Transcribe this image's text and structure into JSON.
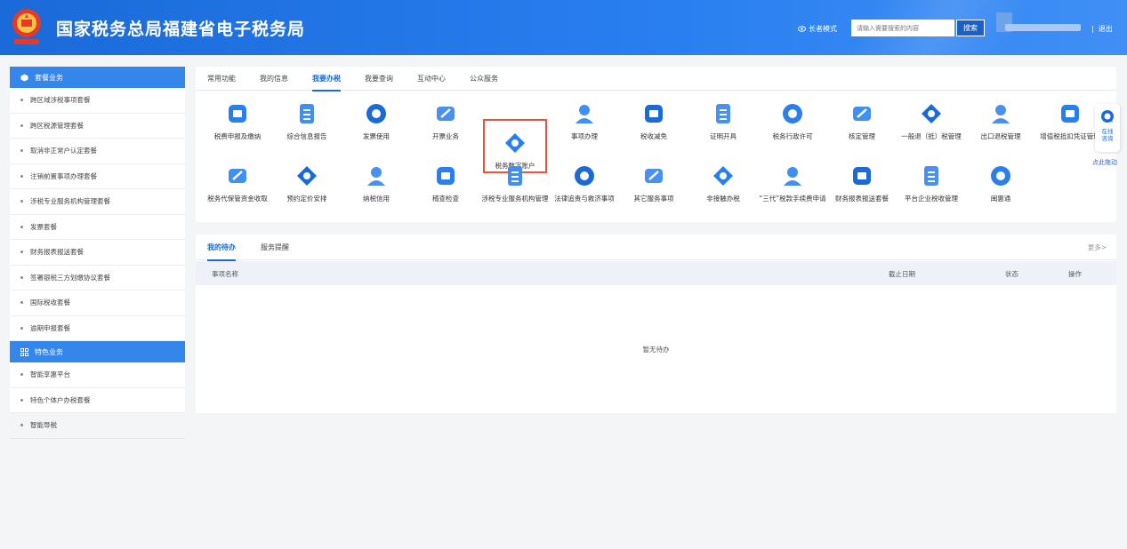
{
  "header": {
    "title": "国家税务总局福建省电子税务局",
    "elder_mode": "长者模式",
    "search_placeholder": "请输入需要搜索的内容",
    "search_button": "搜索",
    "logout": "退出",
    "divider": "|",
    "colors": {
      "primary": "#1a6ad9",
      "highlight": "#e8543b"
    }
  },
  "sidebar": {
    "section1": {
      "title": "套餐业务",
      "icon": "package-icon"
    },
    "items1": [
      "跨区域涉税事项套餐",
      "跨区税源管理套餐",
      "取消非正常户认定套餐",
      "注销前置事项办理套餐",
      "涉税专业服务机构管理套餐",
      "发票套餐",
      "财务报表报送套餐",
      "签署银税三方划缴协议套餐",
      "国际税收套餐",
      "逾期申报套餐"
    ],
    "section2": {
      "title": "特色业务",
      "icon": "grid-icon"
    },
    "items2": [
      "智能享惠平台",
      "特色个体户办税套餐",
      "智能导税"
    ]
  },
  "main": {
    "tabs": [
      "常用功能",
      "我的信息",
      "我要办税",
      "我要查询",
      "互动中心",
      "公众服务"
    ],
    "active_tab": "我要办税",
    "services_row1": [
      {
        "label": "税费申报及缴纳",
        "icon": "tax-declare-icon"
      },
      {
        "label": "综合信息报告",
        "icon": "report-icon"
      },
      {
        "label": "发票使用",
        "icon": "invoice-icon"
      },
      {
        "label": "开票业务",
        "icon": "issue-invoice-icon"
      },
      {
        "label": "税务数字账户",
        "icon": "digital-account-icon"
      },
      {
        "label": "事项办理",
        "icon": "edit-icon"
      },
      {
        "label": "税收减免",
        "icon": "tax-relief-icon"
      },
      {
        "label": "证明开具",
        "icon": "certificate-icon"
      },
      {
        "label": "税务行政许可",
        "icon": "license-icon"
      },
      {
        "label": "核定管理",
        "icon": "verify-manage-icon"
      },
      {
        "label": "一般退（抵）税管理",
        "icon": "refund-icon"
      },
      {
        "label": "出口退税管理",
        "icon": "export-refund-icon"
      },
      {
        "label": "增值税抵扣凭证管理",
        "icon": "vat-voucher-icon"
      }
    ],
    "services_row2": [
      {
        "label": "税务代保管资金收取",
        "icon": "money-bag-icon"
      },
      {
        "label": "预约定价安排",
        "icon": "pricing-icon"
      },
      {
        "label": "纳税信用",
        "icon": "credit-icon"
      },
      {
        "label": "稽查检查",
        "icon": "inspector-icon"
      },
      {
        "label": "涉税专业服务机构管理",
        "icon": "agency-icon"
      },
      {
        "label": "法律追责与救济事项",
        "icon": "gavel-icon"
      },
      {
        "label": "其它服务事项",
        "icon": "other-service-icon"
      },
      {
        "label": "非接触办税",
        "icon": "contactless-icon"
      },
      {
        "label": "“三代”税款手续费申请",
        "icon": "fee-apply-icon"
      },
      {
        "label": "财务报表报送套餐",
        "icon": "financial-report-icon"
      },
      {
        "label": "平台企业税收管理",
        "icon": "platform-tax-icon"
      },
      {
        "label": "闽惠通",
        "icon": "bulb-icon"
      }
    ],
    "highlighted": "税务数字账户"
  },
  "float": {
    "line1": "在线",
    "line2": "咨询",
    "drag_hint": "点此拖动"
  },
  "todo": {
    "tabs": [
      "我的待办",
      "服务提醒"
    ],
    "more": "更多>",
    "columns": {
      "name": "事项名称",
      "deadline": "截止日期",
      "status": "状态",
      "action": "操作"
    },
    "empty": "暂无待办"
  }
}
